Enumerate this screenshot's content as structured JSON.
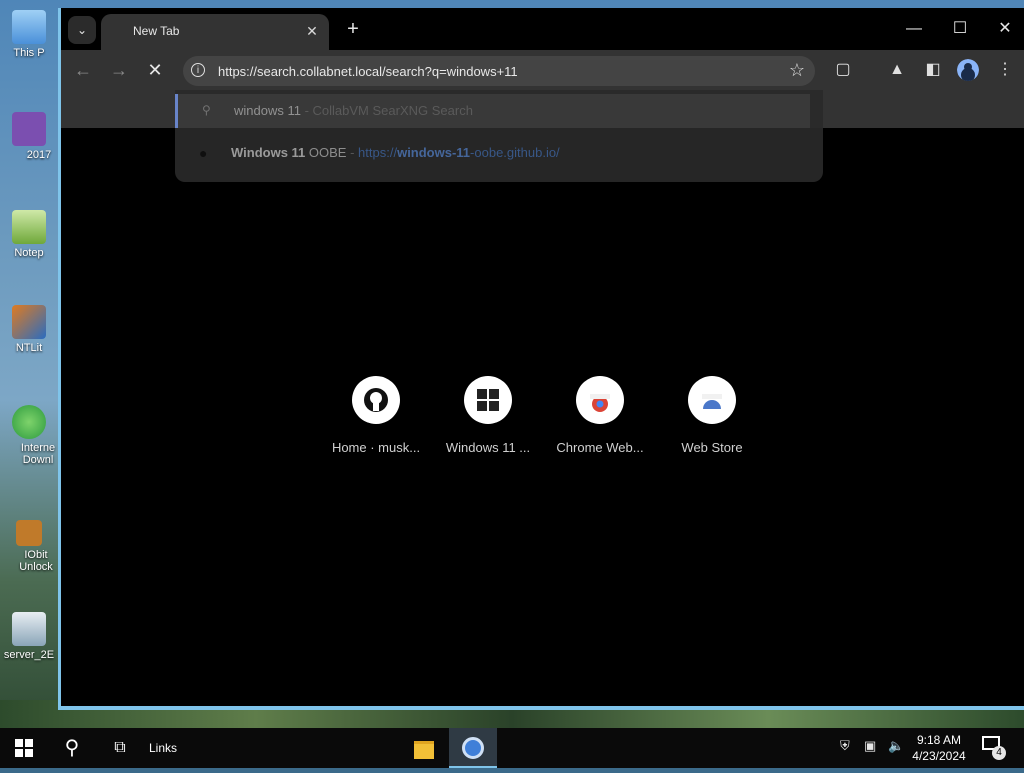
{
  "desktop": {
    "icons": [
      {
        "label": "This P",
        "color": "#4a90d9"
      },
      {
        "label": "2017",
        "color": "#7b4fb0"
      },
      {
        "label": "Notep",
        "color": "#6fa83a"
      },
      {
        "label": "NTLit",
        "color": "#e07b20"
      },
      {
        "label": "Interne Downl",
        "color": "#2c9a3e"
      },
      {
        "label": "IObit Unlock",
        "color": "#c07a2a"
      },
      {
        "label": "server_2E",
        "color": "#8aa5b8"
      }
    ]
  },
  "browser": {
    "tab": {
      "title": "New Tab"
    },
    "address_url": "https://search.collabnet.local/search?q=windows+11",
    "suggestions": [
      {
        "query": "windows 11",
        "separator": " - ",
        "source": "CollabVM SearXNG Search"
      },
      {
        "title_bold": "Windows 11",
        "title_rest": " OOBE",
        "separator": " - ",
        "url_pre": "https://",
        "url_bold": "windows-11",
        "url_post": "-oobe.github.io/"
      }
    ],
    "shortcuts": [
      {
        "label": "Home · musk...",
        "icon": "github-icon"
      },
      {
        "label": "Windows 11 ...",
        "icon": "windows-icon"
      },
      {
        "label": "Chrome Web...",
        "icon": "chrome-icon"
      },
      {
        "label": "Web Store",
        "icon": "web-store-icon"
      }
    ]
  },
  "taskbar": {
    "links_label": "Links",
    "time": "9:18 AM",
    "date": "4/23/2024",
    "notification_count": "4"
  },
  "colors": {
    "accent_blue": "#7fc4ea",
    "tab_bg": "#333333",
    "content_bg": "#000000"
  }
}
